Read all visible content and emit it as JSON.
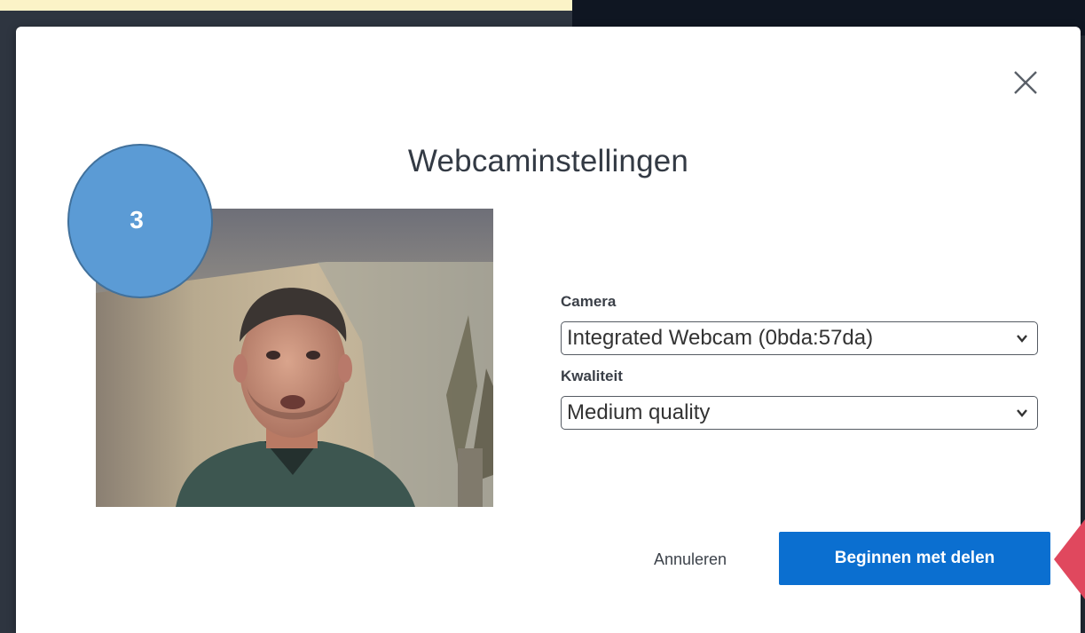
{
  "dialog": {
    "title": "Webcaminstellingen",
    "close_icon": "close-icon"
  },
  "form": {
    "camera_label": "Camera",
    "camera_value": "Integrated Webcam (0bda:57da)",
    "quality_label": "Kwaliteit",
    "quality_value": "Medium quality"
  },
  "buttons": {
    "cancel_label": "Annuleren",
    "start_label": "Beginnen met delen"
  },
  "annotation": {
    "step_number": "3"
  },
  "colors": {
    "primary_button": "#0b6fd0",
    "step_circle": "#5b9bd5",
    "arrow": "#e0485e"
  }
}
